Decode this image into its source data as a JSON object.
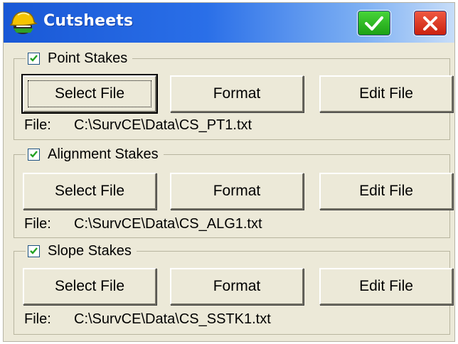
{
  "window": {
    "title": "Cutsheets",
    "icon": "surveyor-hardhat-icon",
    "ok_icon": "checkmark-icon",
    "close_icon": "close-x-icon"
  },
  "groups": [
    {
      "label": "Point Stakes",
      "checked": true,
      "buttons": {
        "select": "Select File",
        "format": "Format",
        "edit": "Edit File"
      },
      "file_label": "File:",
      "file_path": "C:\\SurvCE\\Data\\CS_PT1.txt"
    },
    {
      "label": "Alignment Stakes",
      "checked": true,
      "buttons": {
        "select": "Select File",
        "format": "Format",
        "edit": "Edit File"
      },
      "file_label": "File:",
      "file_path": "C:\\SurvCE\\Data\\CS_ALG1.txt"
    },
    {
      "label": "Slope Stakes",
      "checked": true,
      "buttons": {
        "select": "Select File",
        "format": "Format",
        "edit": "Edit File"
      },
      "file_label": "File:",
      "file_path": "C:\\SurvCE\\Data\\CS_SSTK1.txt"
    }
  ],
  "colors": {
    "titlebar_start": "#1958d6",
    "titlebar_end": "#c7ddf9",
    "ok_green": "#1b9f13",
    "close_red": "#c91f0d",
    "dialog_bg": "#ece9d8"
  }
}
